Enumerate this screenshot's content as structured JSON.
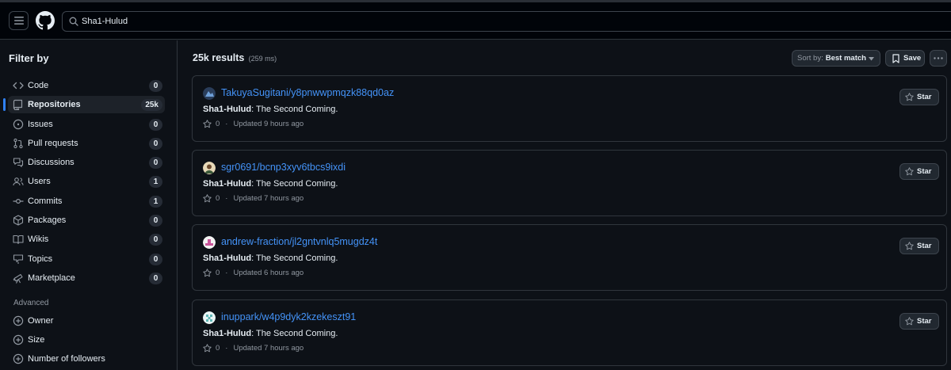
{
  "search": {
    "query": "Sha1-Hulud"
  },
  "sidebar": {
    "title": "Filter by",
    "items": [
      {
        "label": "Code",
        "count": "0",
        "icon": "code-icon"
      },
      {
        "label": "Repositories",
        "count": "25k",
        "icon": "repo-icon",
        "selected": true
      },
      {
        "label": "Issues",
        "count": "0",
        "icon": "issue-icon"
      },
      {
        "label": "Pull requests",
        "count": "0",
        "icon": "pull-request-icon"
      },
      {
        "label": "Discussions",
        "count": "0",
        "icon": "discussion-icon"
      },
      {
        "label": "Users",
        "count": "1",
        "icon": "people-icon"
      },
      {
        "label": "Commits",
        "count": "1",
        "icon": "commit-icon"
      },
      {
        "label": "Packages",
        "count": "0",
        "icon": "package-icon"
      },
      {
        "label": "Wikis",
        "count": "0",
        "icon": "book-icon"
      },
      {
        "label": "Topics",
        "count": "0",
        "icon": "topic-icon"
      },
      {
        "label": "Marketplace",
        "count": "0",
        "icon": "telescope-icon"
      }
    ],
    "advanced_title": "Advanced",
    "advanced_items": [
      {
        "label": "Owner",
        "icon": "plus-circle-icon"
      },
      {
        "label": "Size",
        "icon": "plus-circle-icon"
      },
      {
        "label": "Number of followers",
        "icon": "plus-circle-icon"
      }
    ]
  },
  "results": {
    "count": "25k results",
    "time": "(259 ms)",
    "sort_prefix": "Sort by:",
    "sort_value": "Best match",
    "save_label": "Save",
    "items": [
      {
        "repo": "TakuyaSugitani/y8pnwwpmqzk88qd0az",
        "highlight": "Sha1-Hulud",
        "desc": ": The Second Coming.",
        "stars": "0",
        "updated": "Updated 9 hours ago",
        "star_label": "Star",
        "avatar_color": "#3b6ea8"
      },
      {
        "repo": "sgr0691/bcnp3xyv6tbcs9ixdi",
        "highlight": "Sha1-Hulud",
        "desc": ": The Second Coming.",
        "stars": "0",
        "updated": "Updated 7 hours ago",
        "star_label": "Star",
        "avatar_color": "#c9a27a"
      },
      {
        "repo": "andrew-fraction/jl2gntvnlq5mugdz4t",
        "highlight": "Sha1-Hulud",
        "desc": ": The Second Coming.",
        "stars": "0",
        "updated": "Updated 6 hours ago",
        "star_label": "Star",
        "avatar_color": "#d98bb5"
      },
      {
        "repo": "inuppark/w4p9dyk2kzekeszt91",
        "highlight": "Sha1-Hulud",
        "desc": ": The Second Coming.",
        "stars": "0",
        "updated": "Updated 7 hours ago",
        "star_label": "Star",
        "avatar_color": "#7fc8c8"
      }
    ]
  }
}
